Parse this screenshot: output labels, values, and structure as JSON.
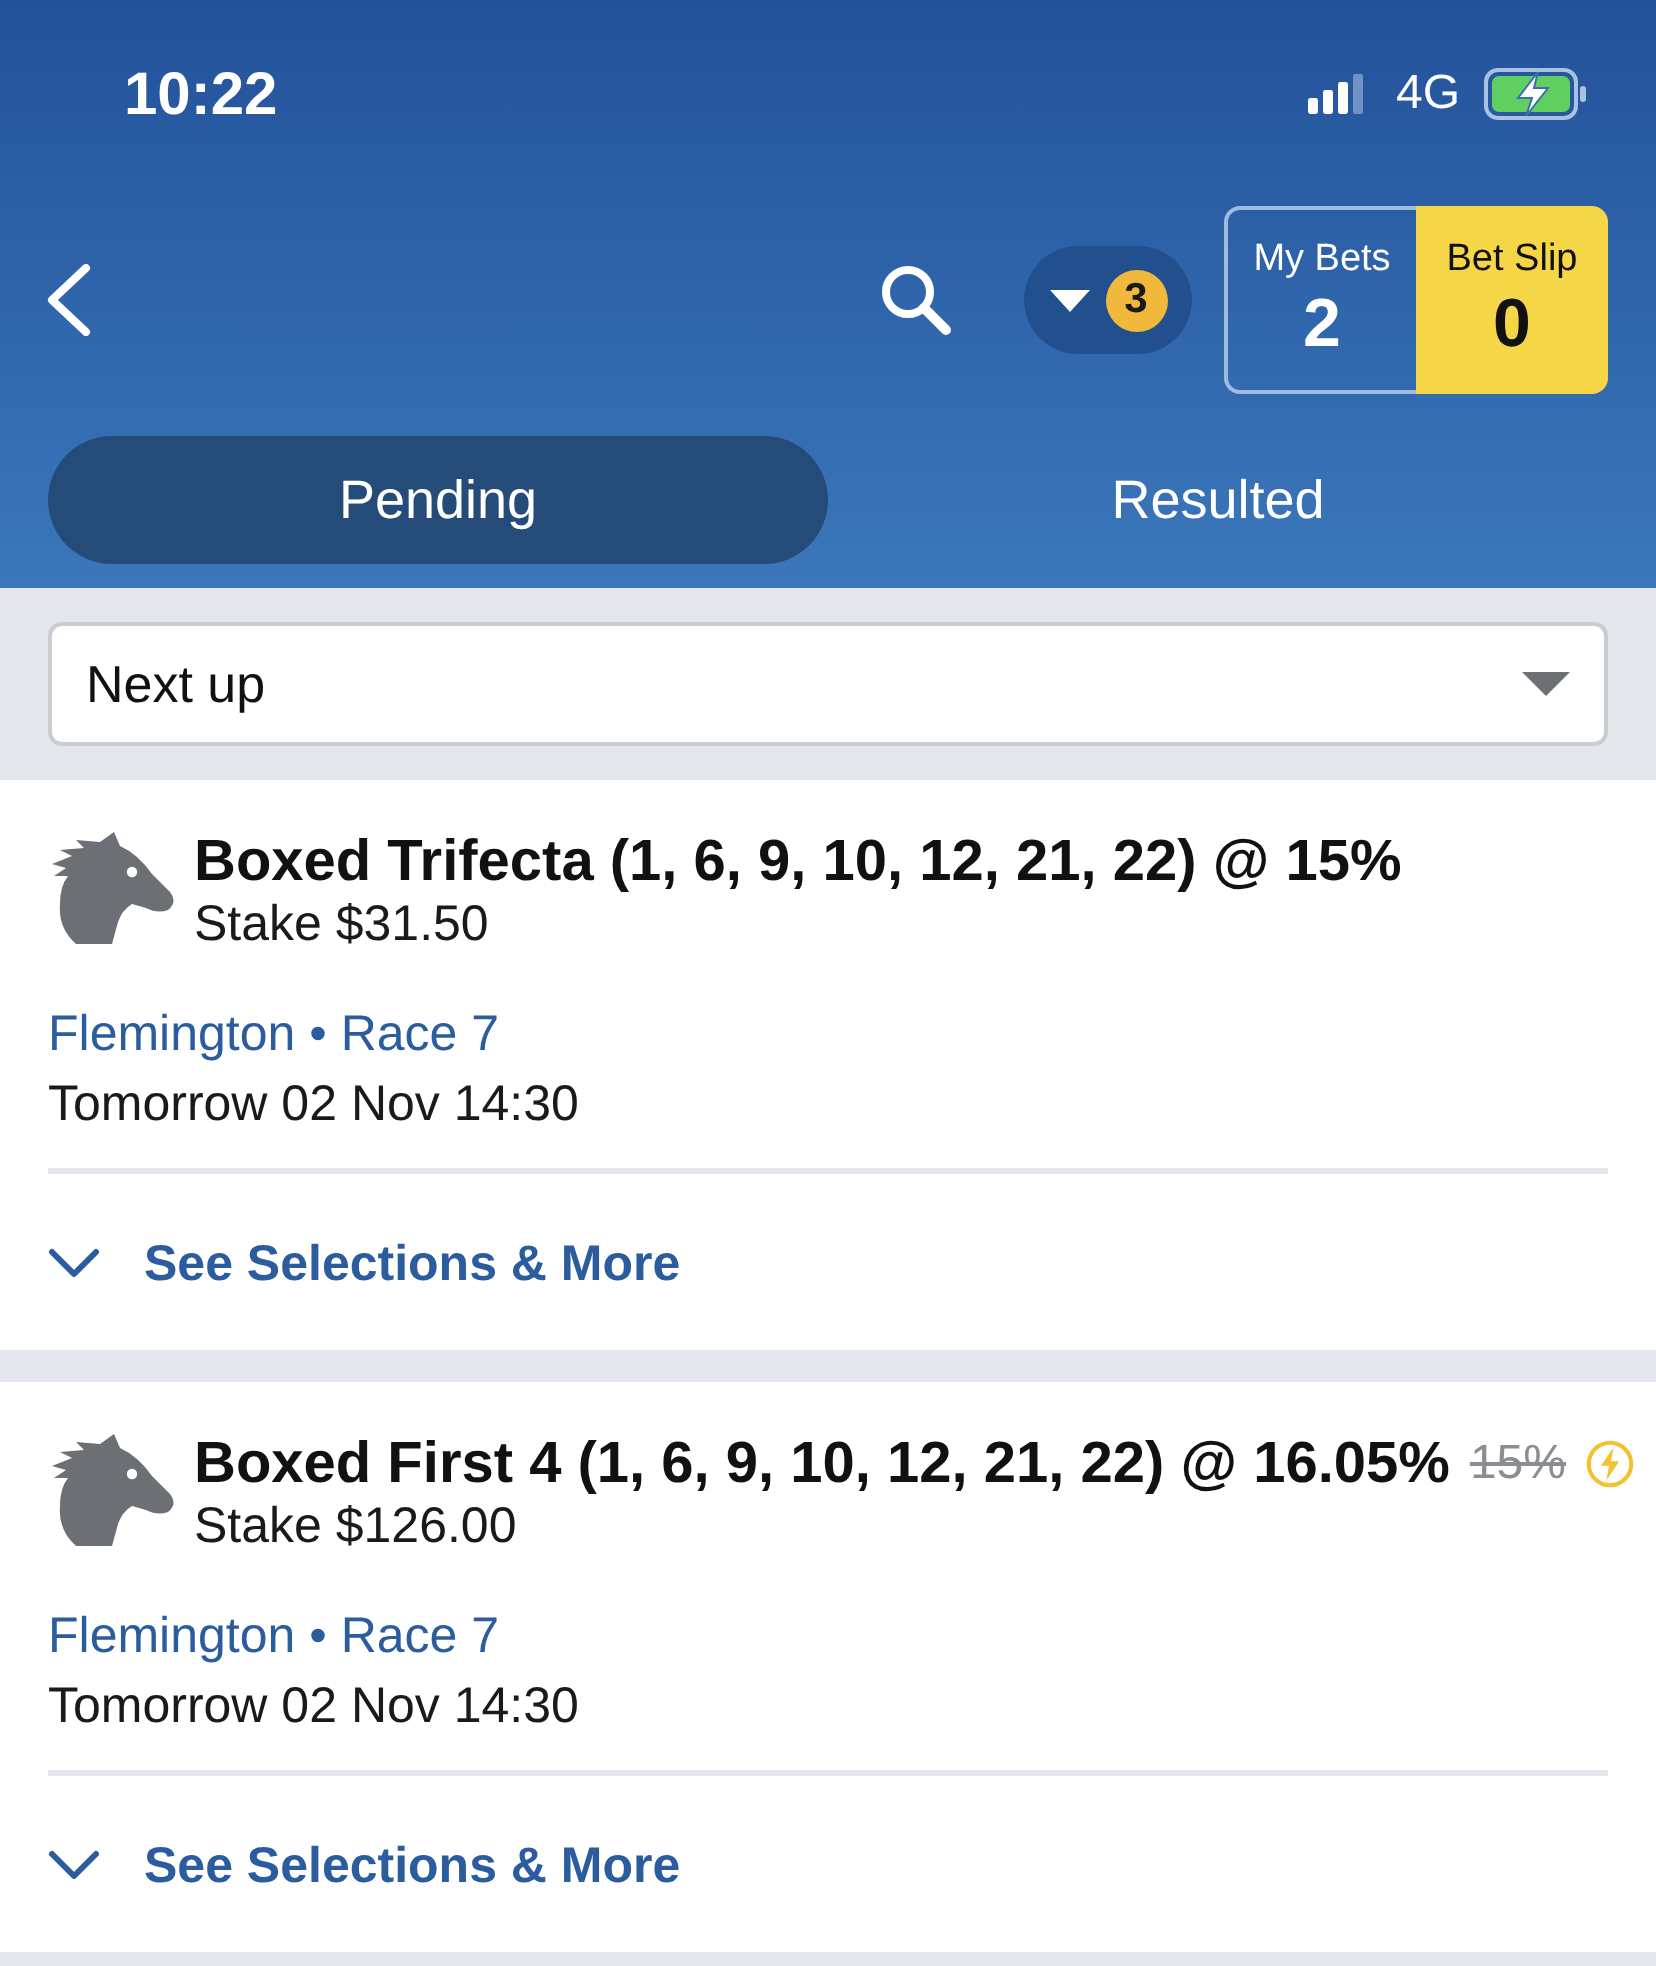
{
  "status_bar": {
    "time": "10:22",
    "network": "4G"
  },
  "nav": {
    "filter_count": "3",
    "my_bets": {
      "label": "My Bets",
      "count": "2"
    },
    "bet_slip": {
      "label": "Bet Slip",
      "count": "0"
    }
  },
  "tabs": [
    {
      "label": "Pending",
      "selected": true
    },
    {
      "label": "Resulted",
      "selected": false
    }
  ],
  "sort_dropdown": {
    "value": "Next up"
  },
  "bets": [
    {
      "title": "Boxed Trifecta (1, 6, 9, 10, 12, 21, 22) @ 15%",
      "boosted": false,
      "stake": "Stake $31.50",
      "meeting": "Flemington • Race 7",
      "start_time": "Tomorrow 02 Nov 14:30",
      "expand_label": "See Selections & More",
      "expanded": false
    },
    {
      "title": "Boxed First 4 (1, 6, 9, 10, 12, 21, 22) @ 16.05%",
      "original_rate": "15%",
      "boosted": true,
      "stake": "Stake $126.00",
      "meeting": "Flemington • Race 7",
      "start_time": "Tomorrow 02 Nov 14:30",
      "expand_label": "See Selections & More",
      "expanded": false
    }
  ]
}
